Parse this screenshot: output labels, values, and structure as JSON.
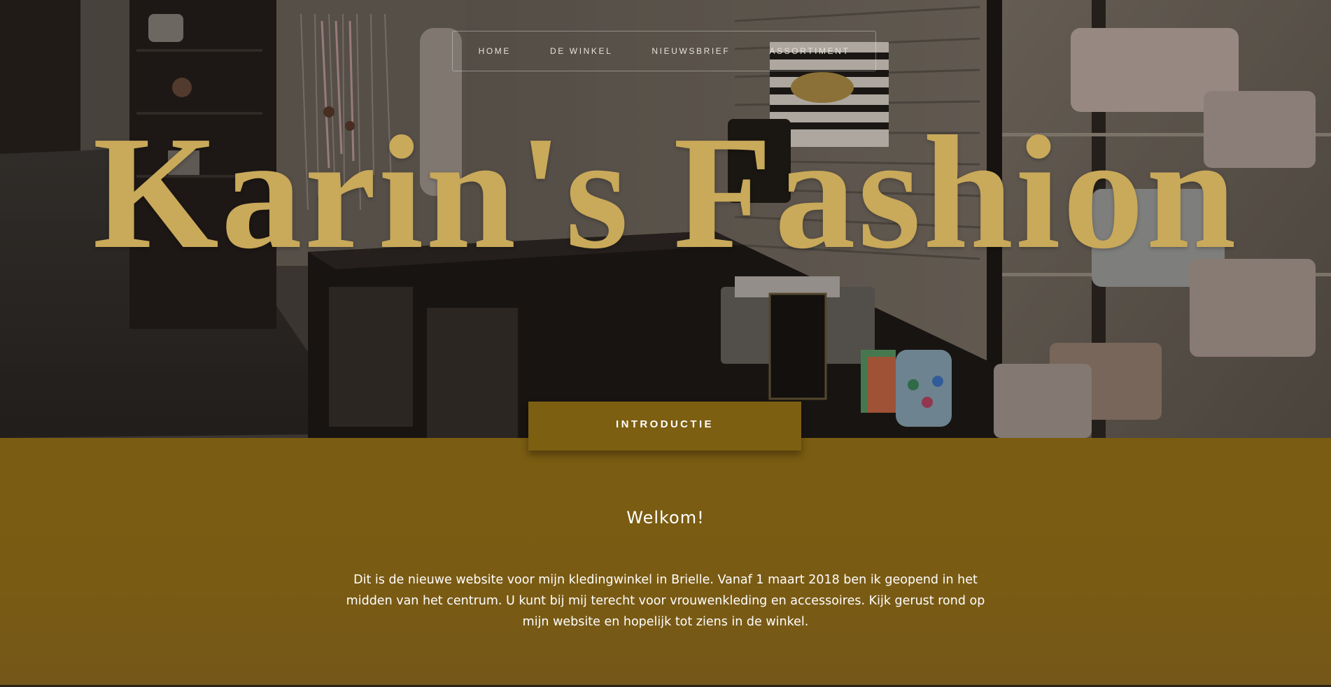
{
  "nav": {
    "items": [
      {
        "label": "HOME"
      },
      {
        "label": "DE WINKEL"
      },
      {
        "label": "NIEUWSBRIEF"
      },
      {
        "label": "ASSORTIMENT"
      }
    ]
  },
  "hero": {
    "title": "Karin's Fashion",
    "intro_tab_label": "INTRODUCTIE"
  },
  "content": {
    "heading": "Welkom!",
    "paragraph": "Dit is de nieuwe website voor mijn kledingwinkel in Brielle. Vanaf 1 maart 2018 ben ik geopend in het midden van het centrum. U kunt bij mij terecht voor vrouwenkleding en accessoires. Kijk gerust rond op mijn website en hopelijk tot ziens in de winkel."
  },
  "colors": {
    "accent_gold": "#c9a95a",
    "section_brown": "#7a5c12"
  }
}
